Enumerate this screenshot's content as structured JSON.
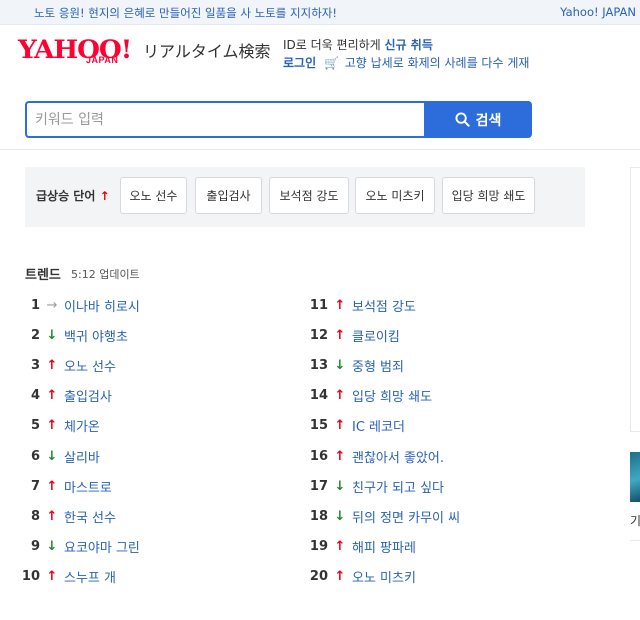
{
  "topbar": {
    "promo": "노토 응원! 현지의 은혜로 만들어진 일품을 사 노토를 지지하자!",
    "corner_link": "Yahoo! JAPAN"
  },
  "logo": {
    "yahoo": "YAHOO!",
    "japan": "JAPAN"
  },
  "product_name": "リアルタイム検索",
  "user": {
    "line1_prefix": "ID로 더욱 편리하게",
    "signup": "신규 취득",
    "login": "로그인",
    "promo": "고향 납세로 화제의 사례를 다수 게재"
  },
  "search": {
    "placeholder": "키워드 입력",
    "button_label": "검색"
  },
  "surge": {
    "label": "급상승 단어",
    "arrow": "↑",
    "chips": [
      "오노 선수",
      "출입검사",
      "보석점 강도",
      "오노 미츠키",
      "입당 희망 쇄도"
    ]
  },
  "side": {
    "char": "기"
  },
  "trend": {
    "title": "트렌드",
    "updated": "5:12 업데이트",
    "left": [
      {
        "rank": "1",
        "dir": "flat",
        "arrow": "→",
        "term": "이나바 히로시"
      },
      {
        "rank": "2",
        "dir": "down",
        "arrow": "↓",
        "term": "백귀 야행초"
      },
      {
        "rank": "3",
        "dir": "up",
        "arrow": "↑",
        "term": "오노 선수"
      },
      {
        "rank": "4",
        "dir": "up",
        "arrow": "↑",
        "term": "출입검사"
      },
      {
        "rank": "5",
        "dir": "up",
        "arrow": "↑",
        "term": "체가온"
      },
      {
        "rank": "6",
        "dir": "down",
        "arrow": "↓",
        "term": "살리바"
      },
      {
        "rank": "7",
        "dir": "up",
        "arrow": "↑",
        "term": "마스트로"
      },
      {
        "rank": "8",
        "dir": "up",
        "arrow": "↑",
        "term": "한국 선수"
      },
      {
        "rank": "9",
        "dir": "down",
        "arrow": "↓",
        "term": "요코야마 그린"
      },
      {
        "rank": "10",
        "dir": "up",
        "arrow": "↑",
        "term": "스누프 개"
      }
    ],
    "right": [
      {
        "rank": "11",
        "dir": "up",
        "arrow": "↑",
        "term": "보석점 강도"
      },
      {
        "rank": "12",
        "dir": "up",
        "arrow": "↑",
        "term": "클로이킴"
      },
      {
        "rank": "13",
        "dir": "down",
        "arrow": "↓",
        "term": "중형 범죄"
      },
      {
        "rank": "14",
        "dir": "up",
        "arrow": "↑",
        "term": "입당 희망 쇄도"
      },
      {
        "rank": "15",
        "dir": "up",
        "arrow": "↑",
        "term": "IC 레코더"
      },
      {
        "rank": "16",
        "dir": "up",
        "arrow": "↑",
        "term": "괜찮아서 좋았어."
      },
      {
        "rank": "17",
        "dir": "down",
        "arrow": "↓",
        "term": "친구가 되고 싶다"
      },
      {
        "rank": "18",
        "dir": "down",
        "arrow": "↓",
        "term": "뒤의 정면 카무이 씨"
      },
      {
        "rank": "19",
        "dir": "up",
        "arrow": "↑",
        "term": "해피 팡파레"
      },
      {
        "rank": "20",
        "dir": "up",
        "arrow": "↑",
        "term": "오노 미츠키"
      }
    ]
  },
  "colors": {
    "link": "#2962b6",
    "accent": "#2d6cdb",
    "up": "#e60012",
    "down": "#1f8b2c",
    "brand": "#ff0033"
  }
}
